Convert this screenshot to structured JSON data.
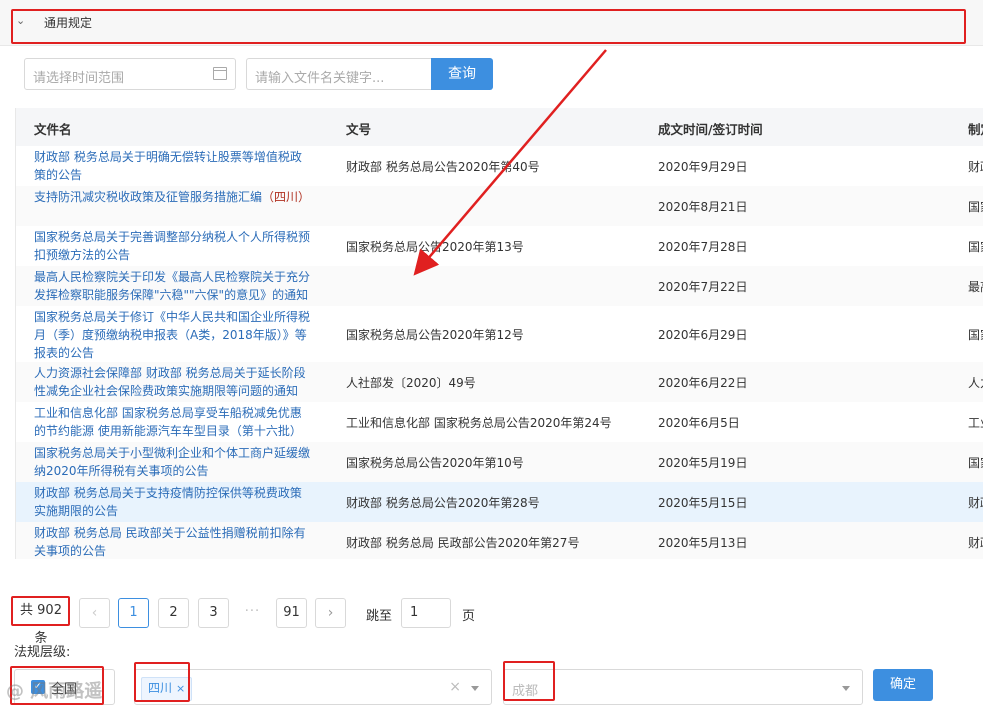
{
  "section": {
    "title": "通用规定"
  },
  "search": {
    "date_placeholder": "请选择时间范围",
    "keyword_placeholder": "请输入文件名关键字...",
    "query_button": "查询"
  },
  "table": {
    "headers": [
      "文件名",
      "文号",
      "成文时间/签订时间",
      "制定"
    ],
    "rows": [
      {
        "name": "财政部 税务总局关于明确无偿转让股票等增值税政策的公告",
        "number": "财政部 税务总局公告2020年第40号",
        "date": "2020年9月29日",
        "maker": "财政"
      },
      {
        "name": "支持防汛减灾税收政策及征管服务措施汇编",
        "name_tag": "（四川）",
        "number": "",
        "date": "2020年8月21日",
        "maker": "国家"
      },
      {
        "name": "国家税务总局关于完善调整部分纳税人个人所得税预扣预缴方法的公告",
        "number": "国家税务总局公告2020年第13号",
        "date": "2020年7月28日",
        "maker": "国家"
      },
      {
        "name": "最高人民检察院关于印发《最高人民检察院关于充分发挥检察职能服务保障\"六稳\"\"六保\"的意见》的通知",
        "number": "",
        "date": "2020年7月22日",
        "maker": "最高"
      },
      {
        "name": "国家税务总局关于修订《中华人民共和国企业所得税月（季）度预缴纳税申报表（A类，2018年版）》等报表的公告",
        "number": "国家税务总局公告2020年第12号",
        "date": "2020年6月29日",
        "maker": "国家"
      },
      {
        "name": "人力资源社会保障部 财政部 税务总局关于延长阶段性减免企业社会保险费政策实施期限等问题的通知",
        "number": "人社部发〔2020〕49号",
        "date": "2020年6月22日",
        "maker": "人力"
      },
      {
        "name": "工业和信息化部 国家税务总局享受车船税减免优惠的节约能源 使用新能源汽车车型目录（第十六批）",
        "number": "工业和信息化部 国家税务总局公告2020年第24号",
        "date": "2020年6月5日",
        "maker": "工业"
      },
      {
        "name": "国家税务总局关于小型微利企业和个体工商户延缓缴纳2020年所得税有关事项的公告",
        "number": "国家税务总局公告2020年第10号",
        "date": "2020年5月19日",
        "maker": "国家"
      },
      {
        "name": "财政部 税务总局关于支持疫情防控保供等税费政策实施期限的公告",
        "number": "财政部 税务总局公告2020年第28号",
        "date": "2020年5月15日",
        "maker": "财政"
      },
      {
        "name": "财政部 税务总局 民政部关于公益性捐赠税前扣除有关事项的公告",
        "number": "财政部 税务总局 民政部公告2020年第27号",
        "date": "2020年5月13日",
        "maker": "财政"
      }
    ]
  },
  "pagination": {
    "total": "共 902 条",
    "prev": "‹",
    "pages": [
      "1",
      "2",
      "3",
      "···",
      "91"
    ],
    "next": "›",
    "jump_label": "跳至",
    "jump_value": "1",
    "page_unit": "页"
  },
  "level": {
    "label": "法规层级:",
    "national": "全国",
    "province_tag": "四川",
    "city_placeholder": "成都",
    "confirm": "确定"
  },
  "watermark": "@ 风雨路遥",
  "colors": {
    "accent": "#3d8fe0",
    "link": "#2b6cb8",
    "annotation": "#e02020"
  }
}
